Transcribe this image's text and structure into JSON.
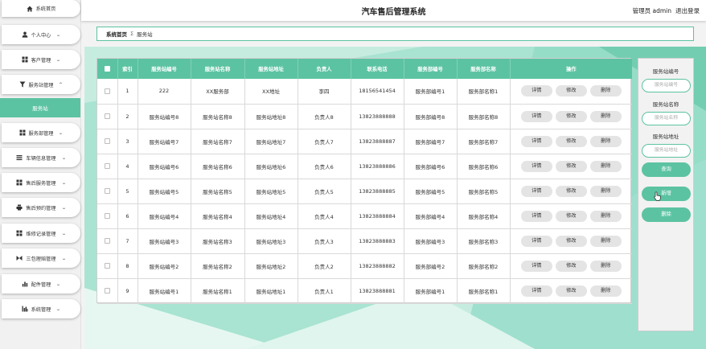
{
  "header": {
    "title": "汽车售后管理系统",
    "user": "管理员 admin",
    "logout": "退出登录"
  },
  "sidebar": {
    "items": [
      {
        "label": "系统首页",
        "icon": "home-icon"
      },
      {
        "label": "个人中心",
        "icon": "user-icon"
      },
      {
        "label": "客户管理",
        "icon": "grid-icon"
      },
      {
        "label": "服务站管理",
        "icon": "filter-icon"
      },
      {
        "label": "服务部管理",
        "icon": "grid-icon"
      },
      {
        "label": "车辆信息管理",
        "icon": "list-icon"
      },
      {
        "label": "售后服务管理",
        "icon": "grid-icon"
      },
      {
        "label": "售后预约管理",
        "icon": "printer-icon"
      },
      {
        "label": "维修记录管理",
        "icon": "grid-icon"
      },
      {
        "label": "三包理赔管理",
        "icon": "bowtie-icon"
      },
      {
        "label": "配件管理",
        "icon": "bar-chart-icon"
      },
      {
        "label": "系统管理",
        "icon": "chart-icon"
      }
    ],
    "active_sub": "服务站"
  },
  "breadcrumb": {
    "home": "系统首页",
    "sep": "Σ",
    "current": "服务站"
  },
  "table": {
    "headers": [
      "索引",
      "服务站编号",
      "服务站名称",
      "服务站地址",
      "负责人",
      "联系电话",
      "服务部编号",
      "服务部名称",
      "操作"
    ],
    "rows": [
      [
        "1",
        "222",
        "XX服务部",
        "XX地址",
        "李四",
        "18156541454",
        "服务部编号1",
        "服务部名称1"
      ],
      [
        "2",
        "服务站编号8",
        "服务站名称8",
        "服务站地址8",
        "负责人8",
        "13823888888",
        "服务部编号8",
        "服务部名称8"
      ],
      [
        "3",
        "服务站编号7",
        "服务站名称7",
        "服务站地址7",
        "负责人7",
        "13823888887",
        "服务部编号7",
        "服务部名称7"
      ],
      [
        "4",
        "服务站编号6",
        "服务站名称6",
        "服务站地址6",
        "负责人6",
        "13823888886",
        "服务部编号6",
        "服务部名称6"
      ],
      [
        "5",
        "服务站编号5",
        "服务站名称5",
        "服务站地址5",
        "负责人5",
        "13823888885",
        "服务部编号5",
        "服务部名称5"
      ],
      [
        "6",
        "服务站编号4",
        "服务站名称4",
        "服务站地址4",
        "负责人4",
        "13823888884",
        "服务部编号4",
        "服务部名称4"
      ],
      [
        "7",
        "服务站编号3",
        "服务站名称3",
        "服务站地址3",
        "负责人3",
        "13823888883",
        "服务部编号3",
        "服务部名称3"
      ],
      [
        "8",
        "服务站编号2",
        "服务站名称2",
        "服务站地址2",
        "负责人2",
        "13823888882",
        "服务部编号2",
        "服务部名称2"
      ],
      [
        "9",
        "服务站编号1",
        "服务站名称1",
        "服务站地址1",
        "负责人1",
        "13823888881",
        "服务部编号1",
        "服务部名称1"
      ]
    ],
    "actions": {
      "detail": "详情",
      "edit": "修改",
      "delete": "删除"
    }
  },
  "search": {
    "code_label": "服务站编号",
    "code_placeholder": "服务站编号",
    "name_label": "服务站名称",
    "name_placeholder": "服务站名称",
    "addr_label": "服务站地址",
    "addr_placeholder": "服务站地址",
    "query": "查询",
    "add": "新增",
    "delete": "删除"
  },
  "colors": {
    "accent": "#5cc3a2"
  }
}
